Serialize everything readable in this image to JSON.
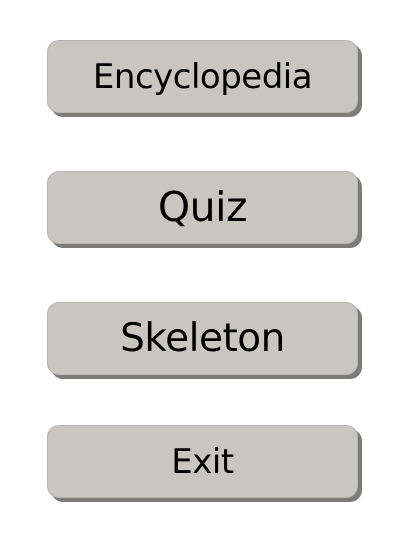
{
  "menu": {
    "buttons": [
      {
        "label": "Encyclopedia"
      },
      {
        "label": "Quiz"
      },
      {
        "label": "Skeleton"
      },
      {
        "label": "Exit"
      }
    ]
  },
  "colors": {
    "background": "#ffffff",
    "button_face": "#c9c6c2",
    "button_shadow": "#7d7b78",
    "text": "#000000"
  }
}
